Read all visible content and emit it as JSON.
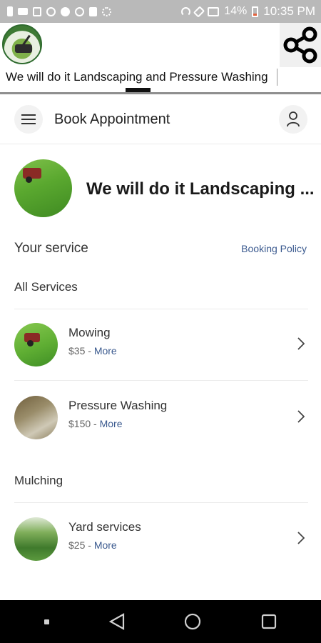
{
  "status_bar": {
    "battery": "14%",
    "time": "10:35 PM",
    "icons": [
      "sim-icon",
      "video-icon",
      "image-icon",
      "instagram-icon",
      "spotify-icon",
      "messenger-icon",
      "lock-icon",
      "signal-icon",
      "headphones-icon",
      "mute-icon",
      "data-icon",
      "battery-icon"
    ]
  },
  "app_header": {
    "title": "We will do it Landscaping and Pressure Washing",
    "share_icon": "share-icon"
  },
  "toolbar": {
    "title": "Book Appointment",
    "menu_icon": "menu-icon",
    "user_icon": "user-icon"
  },
  "business": {
    "name": "We will do it Landscaping ..."
  },
  "services": {
    "section_title": "Your service",
    "policy_link": "Booking Policy",
    "categories": [
      {
        "name": "All Services",
        "items": [
          {
            "name": "Mowing",
            "price": "$35",
            "more": "More"
          },
          {
            "name": "Pressure Washing",
            "price": "$150",
            "more": "More"
          }
        ]
      },
      {
        "name": "Mulching",
        "items": [
          {
            "name": "Yard services",
            "price": "$25",
            "more": "More"
          }
        ]
      }
    ],
    "separator": " - "
  },
  "colors": {
    "link": "#3b5a8f",
    "status_bar": "#b9b9b9",
    "battery_low": "#e2613c",
    "nav_bar": "#000000"
  },
  "nav_bar": {
    "icons": [
      "recent-dot-icon",
      "back-icon",
      "home-icon",
      "overview-icon"
    ]
  }
}
